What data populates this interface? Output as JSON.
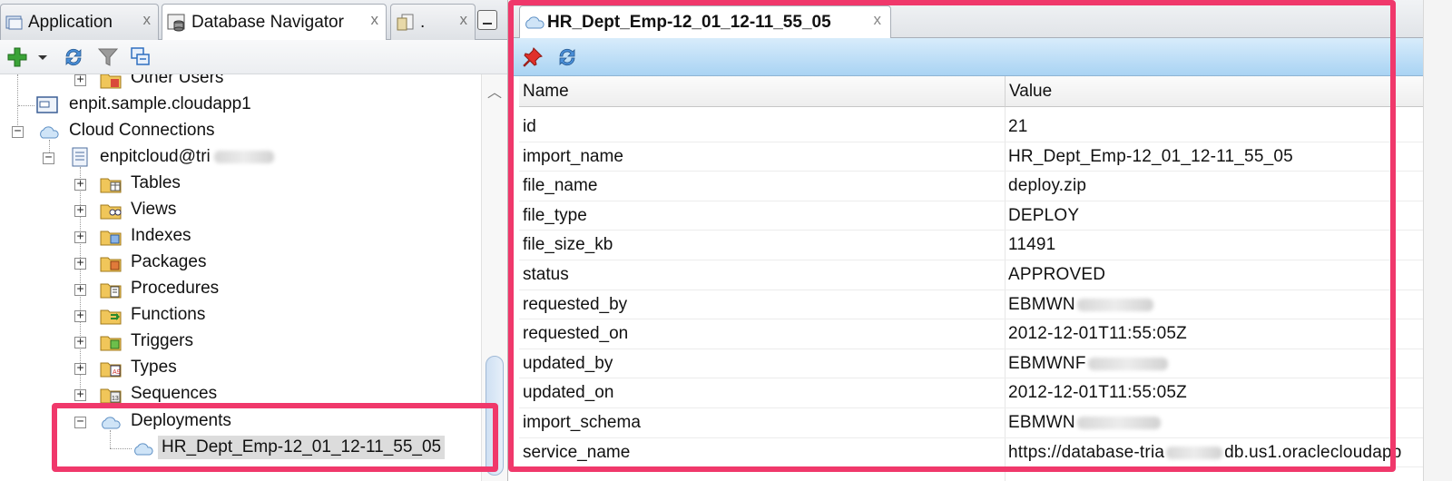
{
  "left_tabs": [
    {
      "label": "Application",
      "icon": "application-icon",
      "close": "x"
    },
    {
      "label": "Database Navigator",
      "icon": "database-navigator-icon",
      "close": "x"
    },
    {
      "label": ".",
      "icon": "file-icon",
      "close": "x"
    }
  ],
  "tree": {
    "other_users": "Other Users",
    "cloudapp": "enpit.sample.cloudapp1",
    "cloud_connections": "Cloud Connections",
    "connection": "enpitcloud@tri",
    "nodes": [
      "Tables",
      "Views",
      "Indexes",
      "Packages",
      "Procedures",
      "Functions",
      "Triggers",
      "Types",
      "Sequences"
    ],
    "deployments": "Deployments",
    "deployment_item": "HR_Dept_Emp-12_01_12-11_55_05",
    "expand_glyph": "+",
    "collapse_glyph": "−"
  },
  "right_tab": {
    "title": "HR_Dept_Emp-12_01_12-11_55_05",
    "close": "x"
  },
  "table": {
    "headers": {
      "name": "Name",
      "value": "Value"
    },
    "rows": [
      {
        "name": "id",
        "value": "21"
      },
      {
        "name": "import_name",
        "value": "HR_Dept_Emp-12_01_12-11_55_05"
      },
      {
        "name": "file_name",
        "value": "deploy.zip"
      },
      {
        "name": "file_type",
        "value": "DEPLOY"
      },
      {
        "name": "file_size_kb",
        "value": "11491"
      },
      {
        "name": "status",
        "value": "APPROVED"
      },
      {
        "name": "requested_by",
        "value": "EBMWN"
      },
      {
        "name": "requested_on",
        "value": "2012-12-01T11:55:05Z"
      },
      {
        "name": "updated_by",
        "value": "EBMWNF"
      },
      {
        "name": "updated_on",
        "value": "2012-12-01T11:55:05Z"
      },
      {
        "name": "import_schema",
        "value": "EBMWN"
      },
      {
        "name": "service_name",
        "value": "https://database-tria",
        "value_suffix": "db.us1.oraclecloudapp"
      }
    ]
  },
  "colors": {
    "highlight": "#f0386b",
    "toolbar_blue": "#a9d3f3",
    "tab_border": "#a8aeb7"
  }
}
